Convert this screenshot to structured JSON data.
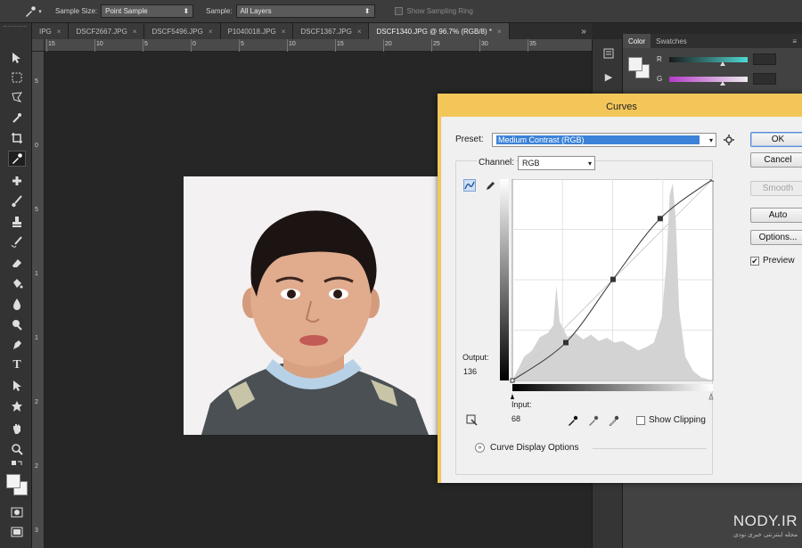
{
  "options_bar": {
    "sample_size_label": "Sample Size:",
    "sample_size_value": "Point Sample",
    "sample_label": "Sample:",
    "sample_value": "All Layers",
    "show_sampling_ring": "Show Sampling Ring"
  },
  "tabs": [
    {
      "label": "IPG",
      "closable": true
    },
    {
      "label": "DSCF2667.JPG",
      "closable": true
    },
    {
      "label": "DSCF5496.JPG",
      "closable": true
    },
    {
      "label": "P1040018.JPG",
      "closable": true
    },
    {
      "label": "DSCF1367.JPG",
      "closable": true
    },
    {
      "label": "DSCF1340.JPG @ 96.7% (RGB/8) *",
      "closable": true,
      "active": true
    }
  ],
  "tabs_overflow": "»",
  "ruler": {
    "h_ticks": [
      "15",
      "10",
      "5",
      "0",
      "5",
      "10",
      "15",
      "20",
      "25",
      "30",
      "35"
    ],
    "v_ticks": [
      "5",
      "0",
      "5",
      "1",
      "1",
      "2",
      "2",
      "3"
    ]
  },
  "panel": {
    "tabs": [
      "Color",
      "Swatches"
    ],
    "rows": [
      {
        "label": "R",
        "value": 0.68,
        "color_from": "#1a1a1a",
        "color_to": "#4fd9d4"
      },
      {
        "label": "G",
        "value": 0.68,
        "color_from": "#b43bc7",
        "color_to": "#ececec"
      }
    ]
  },
  "curves": {
    "title": "Curves",
    "preset_label": "Preset:",
    "preset_value": "Medium Contrast (RGB)",
    "channel_label": "Channel:",
    "channel_value": "RGB",
    "output_label": "Output:",
    "output_value": "136",
    "input_label": "Input:",
    "input_value": "68",
    "show_clipping": "Show Clipping",
    "curve_display_options": "Curve Display Options",
    "buttons": {
      "ok": "OK",
      "cancel": "Cancel",
      "smooth": "Smooth",
      "auto": "Auto",
      "options": "Options..."
    },
    "preview_label": "Preview",
    "preview_checked": true,
    "curve_points": [
      [
        0,
        0
      ],
      [
        68,
        48
      ],
      [
        128,
        128
      ],
      [
        188,
        205
      ],
      [
        255,
        255
      ]
    ],
    "histogram_color": "#d3d3d3"
  },
  "watermark": {
    "brand": "NODY.IR",
    "subtitle": "مجله اینترنتی خبری نودی"
  },
  "colors": {
    "dialog_border": "#f3c65a",
    "preset_highlight": "#3b82d8",
    "workspace": "#282828"
  }
}
